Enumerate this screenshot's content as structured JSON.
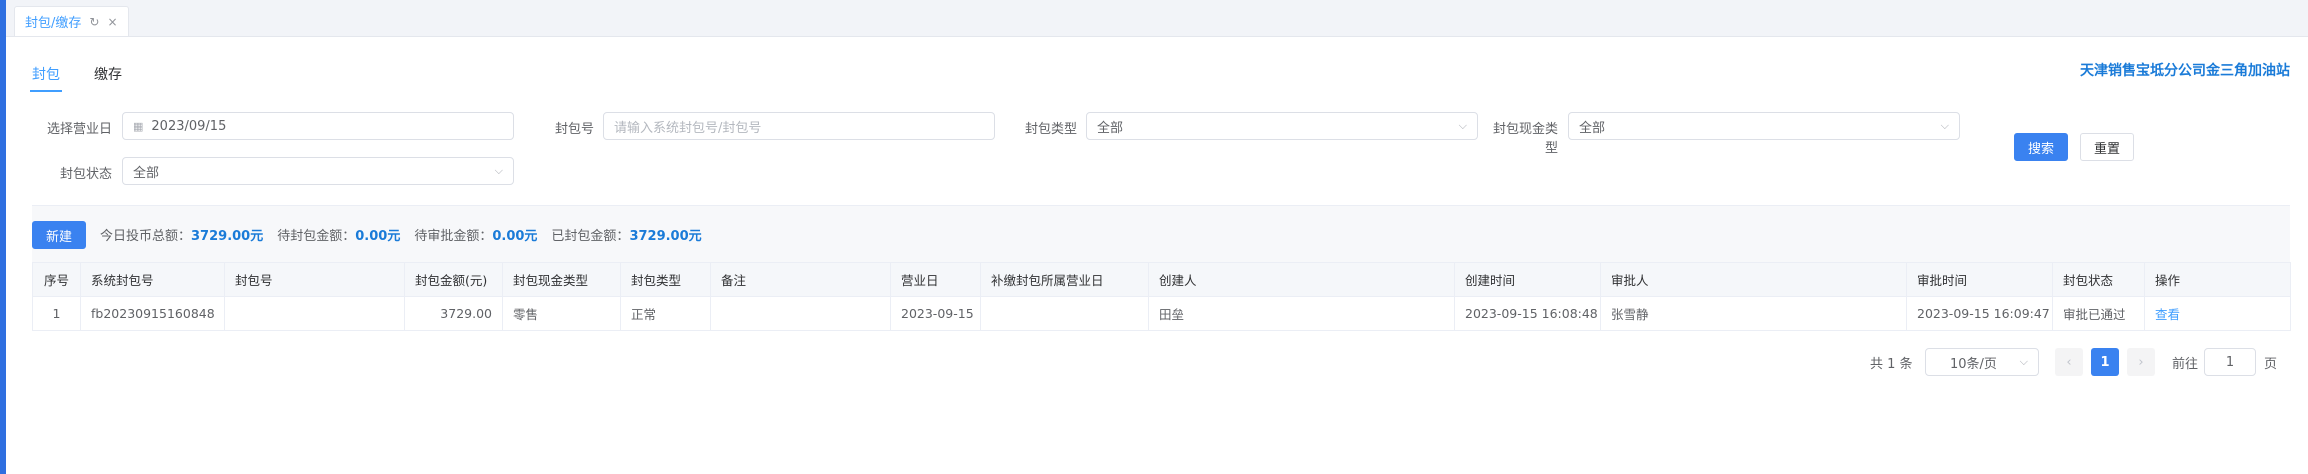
{
  "window_tab": {
    "label": "封包/缴存",
    "refresh_icon": "↻",
    "close_icon": "×"
  },
  "subtabs": [
    {
      "label": "封包",
      "active": true
    },
    {
      "label": "缴存",
      "active": false
    }
  ],
  "station_name": "天津销售宝坻分公司金三角加油站",
  "form": {
    "business_day": {
      "label": "选择营业日",
      "value": "2023/09/15"
    },
    "package_no": {
      "label": "封包号",
      "placeholder": "请输入系统封包号/封包号"
    },
    "package_type": {
      "label": "封包类型",
      "value": "全部"
    },
    "cash_type": {
      "label": "封包现金类型",
      "value": "全部"
    },
    "package_status": {
      "label": "封包状态",
      "value": "全部"
    },
    "search_label": "搜索",
    "reset_label": "重置"
  },
  "toolbar": {
    "new_label": "新建",
    "summary": [
      {
        "label": "今日投币总额：",
        "value": "3729.00元"
      },
      {
        "label": "待封包金额：",
        "value": "0.00元"
      },
      {
        "label": "待审批金额：",
        "value": "0.00元"
      },
      {
        "label": "已封包金额：",
        "value": "3729.00元"
      }
    ]
  },
  "table": {
    "columns": [
      "序号",
      "系统封包号",
      "封包号",
      "封包金额(元)",
      "封包现金类型",
      "封包类型",
      "备注",
      "营业日",
      "补缴封包所属营业日",
      "创建人",
      "创建时间",
      "审批人",
      "审批时间",
      "封包状态",
      "操作"
    ],
    "rows": [
      {
        "index": "1",
        "sys_no": "fb20230915160848",
        "pkg_no": "",
        "amount": "3729.00",
        "cash_type": "零售",
        "pkg_type": "正常",
        "remark": "",
        "business_day": "2023-09-15",
        "supp_day": "",
        "creator": "田垒",
        "created_at": "2023-09-15 16:08:48",
        "approver": "张雪静",
        "approved_at": "2023-09-15 16:09:47",
        "status": "审批已通过",
        "action": "查看"
      }
    ]
  },
  "pagination": {
    "total": "共 1 条",
    "page_size": "10条/页",
    "prev_icon": "‹",
    "current": "1",
    "next_icon": "›",
    "goto_label": "前往",
    "goto_value": "1",
    "page_unit": "页"
  },
  "colors": {
    "accent": "#409eff",
    "primary_button": "#3a82f0",
    "station": "#1a7bd8",
    "left_strip": "#2f6fe0"
  }
}
